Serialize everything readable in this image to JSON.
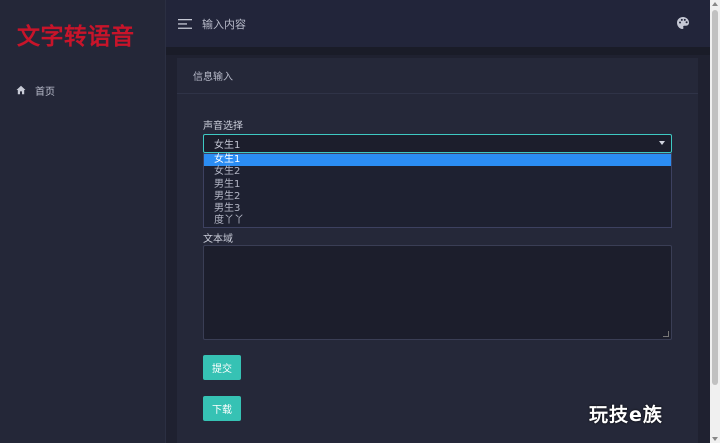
{
  "brand": {
    "title": "文字转语音",
    "color": "#c8142a"
  },
  "sidebar": {
    "items": [
      {
        "icon": "home-icon",
        "label": "首页"
      }
    ]
  },
  "header": {
    "title": "输入内容",
    "menu_icon": "menu-icon",
    "theme_icon": "palette-icon"
  },
  "card": {
    "title": "信息输入",
    "voice_label": "声音选择",
    "voice_selected": "女生1",
    "voice_options": [
      "女生1",
      "女生2",
      "男生1",
      "男生2",
      "男生3",
      "度丫丫"
    ],
    "text_label": "文本域",
    "text_value": "",
    "submit_label": "提交",
    "download_label": "下载"
  },
  "colors": {
    "accent": "#36c2b4",
    "highlight": "#2b8df3",
    "select_border": "#3ec9c3"
  },
  "watermark": "玩技e族"
}
